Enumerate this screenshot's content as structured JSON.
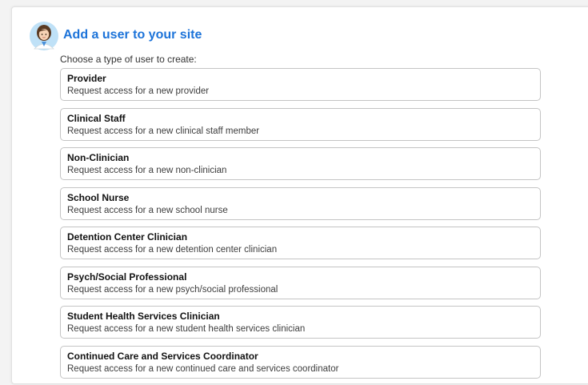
{
  "header": {
    "avatar_icon": "doctor-avatar-icon",
    "title": "Add a user to your site",
    "prompt": "Choose a type of user to create:"
  },
  "user_types": [
    {
      "title": "Provider",
      "description": "Request access for a new provider"
    },
    {
      "title": "Clinical Staff",
      "description": "Request access for a new clinical staff member"
    },
    {
      "title": "Non-Clinician",
      "description": "Request access for a new non-clinician"
    },
    {
      "title": "School Nurse",
      "description": "Request access for a new school nurse"
    },
    {
      "title": "Detention Center Clinician",
      "description": "Request access for a new detention center clinician"
    },
    {
      "title": "Psych/Social Professional",
      "description": "Request access for a new psych/social professional"
    },
    {
      "title": "Student Health Services Clinician",
      "description": "Request access for a new student health services clinician"
    },
    {
      "title": "Continued Care and Services Coordinator",
      "description": "Request access for a new continued care and services coordinator"
    }
  ],
  "colors": {
    "title": "#1c73d9",
    "card_border": "#c4c4c4",
    "background": "#f3f3f3"
  }
}
